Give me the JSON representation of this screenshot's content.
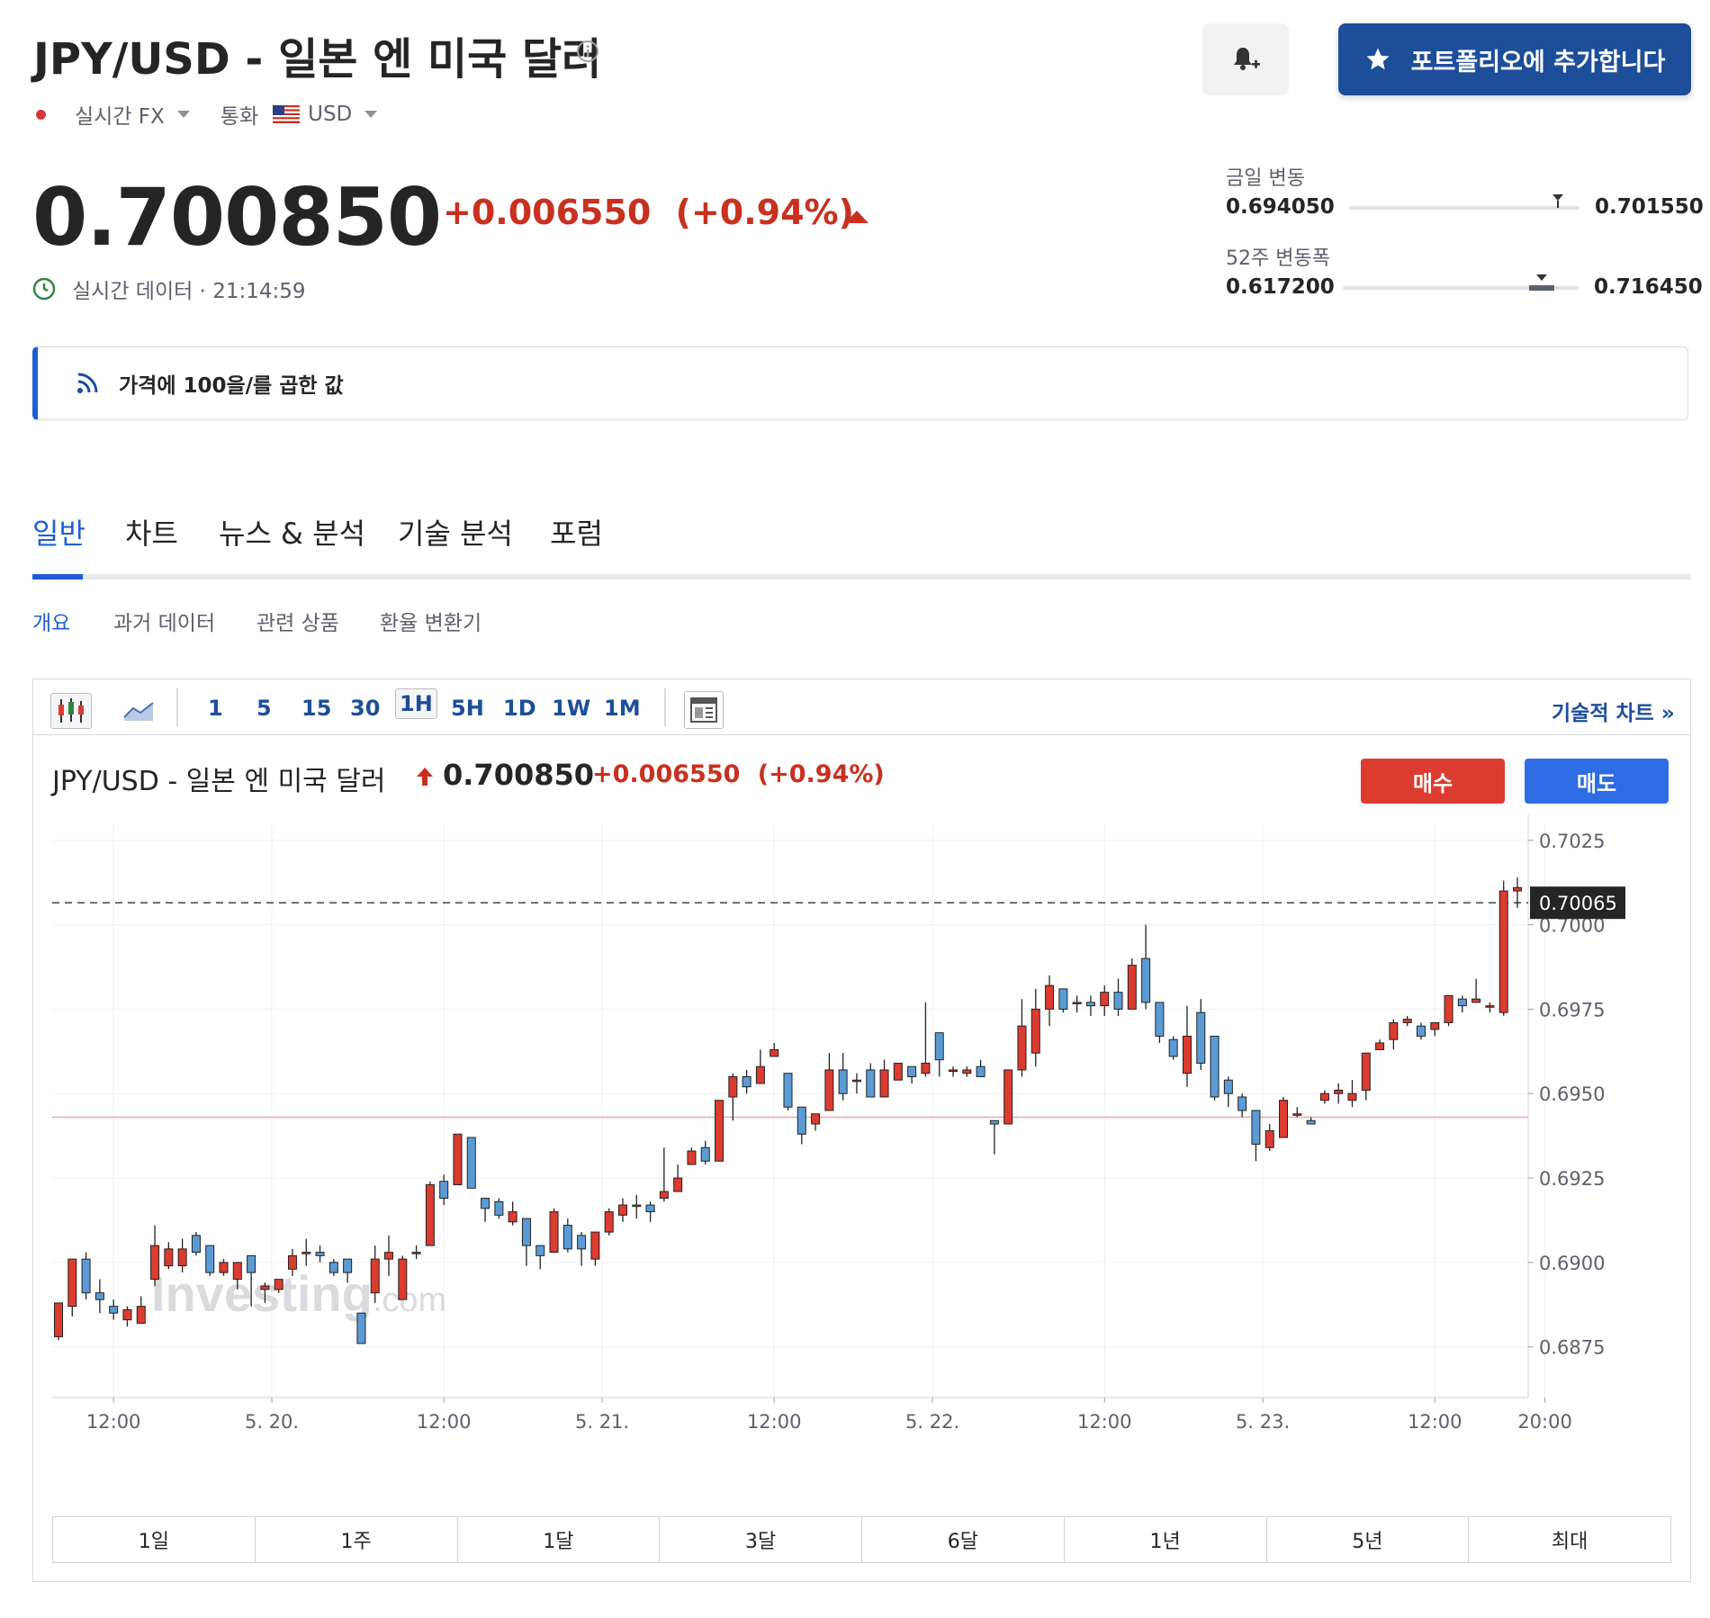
{
  "header": {
    "title": "JPY/USD - 일본 엔 미국 달러",
    "feed": "실시간 FX",
    "currency_label": "통화",
    "currency": "USD",
    "portfolio_button": "포트폴리오에 추가합니다"
  },
  "quote": {
    "price": "0.700850",
    "change": "+0.006550",
    "change_pct": "(+0.94%)",
    "realtime_label": "실시간 데이터 · 21:14:59"
  },
  "ranges": {
    "day": {
      "label": "금일 변동",
      "low": "0.694050",
      "high": "0.701550",
      "current": 0.70085
    },
    "week52": {
      "label": "52주 변동폭",
      "low": "0.617200",
      "high": "0.716450",
      "current": 0.70085
    }
  },
  "news_banner": "가격에 100을/를 곱한 값",
  "tabs": [
    {
      "label": "일반",
      "active": true
    },
    {
      "label": "차트"
    },
    {
      "label": "뉴스 & 분석"
    },
    {
      "label": "기술 분석"
    },
    {
      "label": "포럼"
    }
  ],
  "subtabs": [
    {
      "label": "개요",
      "active": true
    },
    {
      "label": "과거 데이터"
    },
    {
      "label": "관련 상품"
    },
    {
      "label": "환율 변환기"
    }
  ],
  "toolbar": {
    "timeframes": [
      "1",
      "5",
      "15",
      "30",
      "1H",
      "5H",
      "1D",
      "1W",
      "1M"
    ],
    "active_timeframe": "1H",
    "tech_chart_link": "기술적 차트 »"
  },
  "chart_header": {
    "title": "JPY/USD - 일본 엔 미국 달러",
    "price": "0.700850",
    "change": "+0.006550",
    "change_pct": "(+0.94%)",
    "buy": "매수",
    "sell": "매도"
  },
  "watermark": {
    "brand": "Investing",
    "suffix": ".com"
  },
  "periods": [
    "1일",
    "1주",
    "1달",
    "3달",
    "6달",
    "1년",
    "5년",
    "최대"
  ],
  "colors": {
    "up": "#dc3b2f",
    "down": "#5b9bd5",
    "accent": "#1f5fd6",
    "brand": "#1d4e9a"
  },
  "chart_data": {
    "type": "candlestick",
    "ylim": [
      0.686,
      0.703
    ],
    "y_ticks": [
      "0.7025",
      "0.7000",
      "0.6975",
      "0.6950",
      "0.6925",
      "0.6900",
      "0.6875"
    ],
    "x_ticks": [
      {
        "label": "12:00",
        "index": 4
      },
      {
        "label": "5. 20.",
        "index": 15.5
      },
      {
        "label": "12:00",
        "index": 28
      },
      {
        "label": "5. 21.",
        "index": 39.5
      },
      {
        "label": "12:00",
        "index": 52
      },
      {
        "label": "5. 22.",
        "index": 63.5
      },
      {
        "label": "12:00",
        "index": 76
      },
      {
        "label": "5. 23.",
        "index": 87.5
      },
      {
        "label": "12:00",
        "index": 100
      },
      {
        "label": "20:00",
        "index": 108
      }
    ],
    "last_price_label": "0.70065",
    "last_price": 0.70065,
    "reference_price": 0.6943,
    "candles": [
      [
        0.6878,
        0.6888,
        0.6887,
        0.6877
      ],
      [
        0.6887,
        0.6901,
        0.6901,
        0.6884
      ],
      [
        0.6901,
        0.6891,
        0.6903,
        0.6889
      ],
      [
        0.6891,
        0.6889,
        0.6895,
        0.6885
      ],
      [
        0.6887,
        0.6885,
        0.6889,
        0.6883
      ],
      [
        0.6883,
        0.6886,
        0.6887,
        0.6881
      ],
      [
        0.6882,
        0.6887,
        0.689,
        0.6882
      ],
      [
        0.6895,
        0.6905,
        0.6911,
        0.6893
      ],
      [
        0.6899,
        0.6904,
        0.6906,
        0.6898
      ],
      [
        0.6899,
        0.6904,
        0.6907,
        0.6897
      ],
      [
        0.6908,
        0.6903,
        0.6909,
        0.6902
      ],
      [
        0.6905,
        0.6897,
        0.6905,
        0.6896
      ],
      [
        0.6897,
        0.69,
        0.6901,
        0.6896
      ],
      [
        0.6895,
        0.69,
        0.69,
        0.6892
      ],
      [
        0.6902,
        0.6897,
        0.6902,
        0.6887
      ],
      [
        0.6892,
        0.6893,
        0.6894,
        0.6888
      ],
      [
        0.6892,
        0.6895,
        0.6895,
        0.6891
      ],
      [
        0.6898,
        0.6902,
        0.6904,
        0.6896
      ],
      [
        0.6903,
        0.6903,
        0.6907,
        0.6899
      ],
      [
        0.6903,
        0.6902,
        0.6905,
        0.69
      ],
      [
        0.69,
        0.6897,
        0.6901,
        0.6896
      ],
      [
        0.6901,
        0.6897,
        0.6899,
        0.6894
      ],
      [
        0.6885,
        0.6876,
        0.6885,
        0.6876
      ],
      [
        0.6891,
        0.6901,
        0.6905,
        0.6888
      ],
      [
        0.6901,
        0.6903,
        0.6908,
        0.6896
      ],
      [
        0.6889,
        0.6901,
        0.6902,
        0.6889
      ],
      [
        0.6903,
        0.6903,
        0.6905,
        0.6901
      ],
      [
        0.6905,
        0.6923,
        0.6924,
        0.6905
      ],
      [
        0.6924,
        0.6919,
        0.6926,
        0.6917
      ],
      [
        0.6923,
        0.6938,
        0.6938,
        0.6923
      ],
      [
        0.6937,
        0.6922,
        0.6937,
        0.6922
      ],
      [
        0.6919,
        0.6916,
        0.6919,
        0.6912
      ],
      [
        0.6918,
        0.6914,
        0.6919,
        0.6913
      ],
      [
        0.6912,
        0.6915,
        0.6918,
        0.6911
      ],
      [
        0.6913,
        0.6905,
        0.6913,
        0.6899
      ],
      [
        0.6905,
        0.6902,
        0.6904,
        0.6898
      ],
      [
        0.6903,
        0.6915,
        0.6916,
        0.6903
      ],
      [
        0.6911,
        0.6904,
        0.6913,
        0.6903
      ],
      [
        0.6908,
        0.6904,
        0.6909,
        0.6899
      ],
      [
        0.6901,
        0.6909,
        0.6909,
        0.6899
      ],
      [
        0.6909,
        0.6915,
        0.6916,
        0.6908
      ],
      [
        0.6914,
        0.6917,
        0.6919,
        0.6912
      ],
      [
        0.6917,
        0.6917,
        0.692,
        0.6913
      ],
      [
        0.6917,
        0.6915,
        0.6918,
        0.6912
      ],
      [
        0.6919,
        0.6921,
        0.6934,
        0.6918
      ],
      [
        0.6921,
        0.6925,
        0.6929,
        0.6922
      ],
      [
        0.6929,
        0.6933,
        0.6934,
        0.6929
      ],
      [
        0.6934,
        0.693,
        0.6936,
        0.6929
      ],
      [
        0.693,
        0.6948,
        0.6948,
        0.693
      ],
      [
        0.6949,
        0.6955,
        0.6956,
        0.6942
      ],
      [
        0.6955,
        0.6952,
        0.6957,
        0.695
      ],
      [
        0.6953,
        0.6958,
        0.6963,
        0.6953
      ],
      [
        0.6961,
        0.6963,
        0.6965,
        0.6961
      ],
      [
        0.6956,
        0.6946,
        0.6956,
        0.6945
      ],
      [
        0.6946,
        0.6938,
        0.6944,
        0.6935
      ],
      [
        0.6941,
        0.6944,
        0.6943,
        0.6939
      ],
      [
        0.6945,
        0.6957,
        0.6962,
        0.6945
      ],
      [
        0.6957,
        0.695,
        0.6962,
        0.6948
      ],
      [
        0.6954,
        0.6954,
        0.6956,
        0.695
      ],
      [
        0.6957,
        0.6949,
        0.6959,
        0.6949
      ],
      [
        0.6949,
        0.6957,
        0.696,
        0.6949
      ],
      [
        0.6954,
        0.6959,
        0.6957,
        0.6954
      ],
      [
        0.6958,
        0.6955,
        0.6958,
        0.6953
      ],
      [
        0.6956,
        0.6959,
        0.6977,
        0.6955
      ],
      [
        0.6968,
        0.696,
        0.6968,
        0.6955
      ],
      [
        0.6957,
        0.6957,
        0.6958,
        0.6955
      ],
      [
        0.6956,
        0.6957,
        0.6958,
        0.6955
      ],
      [
        0.6958,
        0.6955,
        0.696,
        0.6955
      ],
      [
        0.6942,
        0.6941,
        0.6942,
        0.6932
      ],
      [
        0.6941,
        0.6957,
        0.6955,
        0.6941
      ],
      [
        0.6957,
        0.697,
        0.6978,
        0.6955
      ],
      [
        0.6962,
        0.6975,
        0.6981,
        0.6958
      ],
      [
        0.6975,
        0.6982,
        0.6985,
        0.697
      ],
      [
        0.6981,
        0.6975,
        0.698,
        0.6974
      ],
      [
        0.6977,
        0.6977,
        0.6979,
        0.6974
      ],
      [
        0.6977,
        0.6976,
        0.6979,
        0.6973
      ],
      [
        0.6976,
        0.698,
        0.6982,
        0.6973
      ],
      [
        0.698,
        0.6975,
        0.6984,
        0.6973
      ],
      [
        0.6975,
        0.6988,
        0.699,
        0.6975
      ],
      [
        0.699,
        0.6977,
        0.7,
        0.6975
      ],
      [
        0.6977,
        0.6967,
        0.6977,
        0.6965
      ],
      [
        0.6966,
        0.6961,
        0.6967,
        0.696
      ],
      [
        0.6956,
        0.6967,
        0.6976,
        0.6952
      ],
      [
        0.6974,
        0.6959,
        0.6978,
        0.6957
      ],
      [
        0.6967,
        0.6949,
        0.6967,
        0.6948
      ],
      [
        0.6954,
        0.695,
        0.6955,
        0.6946
      ],
      [
        0.6949,
        0.6945,
        0.695,
        0.6943
      ],
      [
        0.6945,
        0.6935,
        0.6945,
        0.693
      ],
      [
        0.6934,
        0.6939,
        0.6941,
        0.6933
      ],
      [
        0.6937,
        0.6948,
        0.6949,
        0.6937
      ],
      [
        0.6944,
        0.6944,
        0.6946,
        0.6943
      ],
      [
        0.6942,
        0.6941,
        0.6943,
        0.6941
      ],
      [
        0.6948,
        0.695,
        0.6951,
        0.6947
      ],
      [
        0.695,
        0.6951,
        0.6953,
        0.6947
      ],
      [
        0.6948,
        0.695,
        0.6954,
        0.6946
      ],
      [
        0.6951,
        0.6962,
        0.6962,
        0.6948
      ],
      [
        0.6963,
        0.6965,
        0.6966,
        0.6963
      ],
      [
        0.6966,
        0.6971,
        0.6972,
        0.6963
      ],
      [
        0.6971,
        0.6972,
        0.6973,
        0.697
      ],
      [
        0.697,
        0.6967,
        0.6971,
        0.6966
      ],
      [
        0.6969,
        0.6971,
        0.6971,
        0.6967
      ],
      [
        0.6971,
        0.6979,
        0.6979,
        0.697
      ],
      [
        0.6978,
        0.6976,
        0.6979,
        0.6974
      ],
      [
        0.6977,
        0.6978,
        0.6984,
        0.6977
      ],
      [
        0.6976,
        0.6976,
        0.6977,
        0.6974
      ],
      [
        0.6974,
        0.701,
        0.7013,
        0.6973
      ],
      [
        0.701,
        0.7011,
        0.7014,
        0.7005
      ]
    ]
  }
}
